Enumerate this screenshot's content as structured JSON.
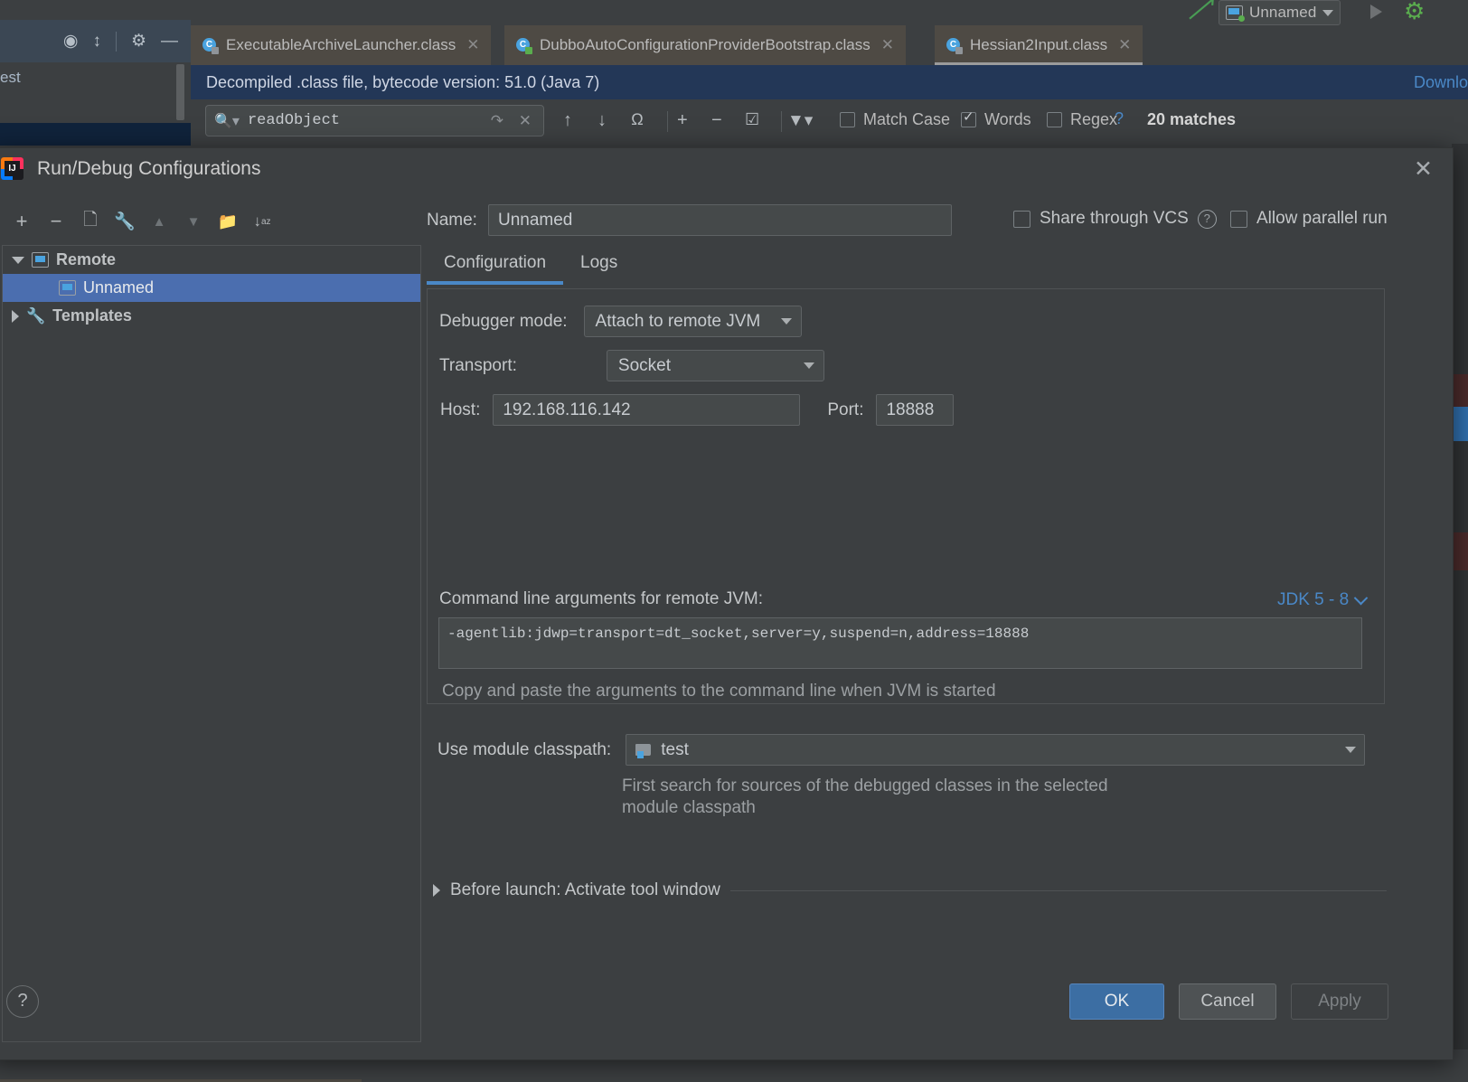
{
  "ide": {
    "run_widget": {
      "label": "Unnamed",
      "icon": "remote-debug-icon"
    },
    "toolwindow": {
      "icons": [
        "crosshair-icon",
        "collapse-all-icon",
        "settings-gear-icon",
        "minimize-icon"
      ],
      "text": "est"
    },
    "tabs": [
      {
        "label": "ExecutableArchiveLauncher.class",
        "active": false,
        "icon": "java-class-icon"
      },
      {
        "label": "DubboAutoConfigurationProviderBootstrap.class",
        "active": false,
        "icon": "java-class-icon"
      },
      {
        "label": "Hessian2Input.class",
        "active": true,
        "icon": "java-class-icon"
      }
    ],
    "banner": {
      "text": "Decompiled .class file, bytecode version: 51.0 (Java 7)",
      "link": "Downlo"
    },
    "find": {
      "query": "readObject",
      "prev_icon": "arrow-up-icon",
      "next_icon": "arrow-down-icon",
      "all_icon": "select-all-occurrences-icon",
      "add_icon": "add-line-icon",
      "remove_icon": "remove-line-icon",
      "check_icon": "check-line-icon",
      "filter_icon": "filter-icon",
      "options": [
        {
          "label": "Match Case",
          "checked": false
        },
        {
          "label": "Words",
          "checked": true
        },
        {
          "label": "Regex",
          "checked": false
        }
      ],
      "help": "?",
      "matches": "20 matches"
    }
  },
  "dialog": {
    "title": "Run/Debug Configurations",
    "close_icon": "close-icon",
    "tree_toolbar": [
      {
        "name": "add-configuration-button",
        "glyph": "+",
        "dim": false
      },
      {
        "name": "remove-configuration-button",
        "glyph": "−",
        "dim": false
      },
      {
        "name": "copy-configuration-button",
        "glyph": "❐",
        "dim": false
      },
      {
        "name": "edit-templates-button",
        "glyph": "ὒ7",
        "dim": false
      },
      {
        "name": "move-up-button",
        "glyph": "▲",
        "dim": true
      },
      {
        "name": "move-down-button",
        "glyph": "▼",
        "dim": true
      },
      {
        "name": "create-folder-button",
        "glyph": "Ὄ1",
        "dim": false
      },
      {
        "name": "sort-alphabetically-button",
        "glyph": "↓",
        "dim": false
      }
    ],
    "tree": [
      {
        "label": "Remote",
        "level": 0,
        "expanded": true,
        "selected": false,
        "icon": "remote-icon",
        "bold": true
      },
      {
        "label": "Unnamed",
        "level": 1,
        "expanded": null,
        "selected": true,
        "icon": "remote-icon",
        "bold": false
      },
      {
        "label": "Templates",
        "level": 0,
        "expanded": false,
        "selected": false,
        "icon": "wrench-icon",
        "bold": true
      }
    ],
    "name_label": "Name:",
    "name_value": "Unnamed",
    "share_vcs": {
      "label": "Share through VCS",
      "checked": false,
      "help_icon": "help-icon"
    },
    "allow_parallel": {
      "label": "Allow parallel run",
      "checked": false
    },
    "tabs": [
      {
        "label": "Configuration",
        "active": true
      },
      {
        "label": "Logs",
        "active": false
      }
    ],
    "fields": {
      "debugger_mode_label": "Debugger mode:",
      "debugger_mode_value": "Attach to remote JVM",
      "transport_label": "Transport:",
      "transport_value": "Socket",
      "host_label": "Host:",
      "host_value": "192.168.116.142",
      "port_label": "Port:",
      "port_value": "18888",
      "args_label": "Command line arguments for remote JVM:",
      "jdk_selector": "JDK 5 - 8",
      "args_value": "-agentlib:jdwp=transport=dt_socket,server=y,suspend=n,address=18888",
      "args_hint": "Copy and paste the arguments to the command line when JVM is started",
      "module_label": "Use module classpath:",
      "module_value": "test",
      "module_hint_line1": "First search for sources of the debugged classes in the selected",
      "module_hint_line2": "module classpath"
    },
    "before_launch": "Before launch: Activate tool window",
    "help_button": "?",
    "buttons": {
      "ok": "OK",
      "cancel": "Cancel",
      "apply": "Apply"
    }
  },
  "colors": {
    "accent_blue": "#4a88c7",
    "selection_blue": "#4b6eaf",
    "banner_blue": "#233757",
    "panel_bg": "#3c3f41",
    "field_bg": "#45494a"
  }
}
